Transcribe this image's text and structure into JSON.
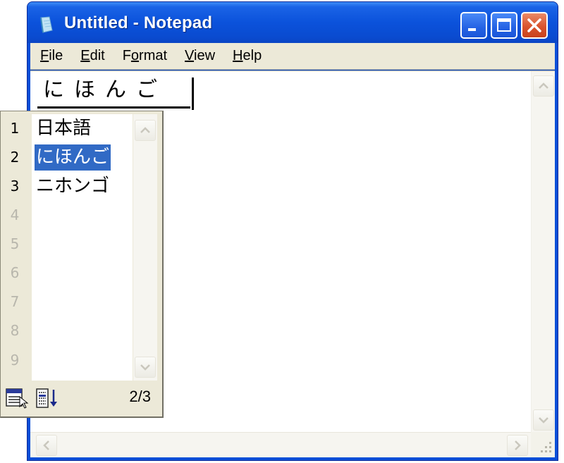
{
  "window": {
    "title": "Untitled - Notepad",
    "app_icon": "notepad-icon",
    "controls": {
      "minimize": "minimize-icon",
      "maximize": "maximize-icon",
      "close": "close-icon"
    },
    "colors": {
      "titlebar": "#0b52db",
      "close_button": "#d9542e",
      "selection": "#316ac5",
      "chrome": "#ece9d8"
    }
  },
  "menu": [
    {
      "accel": "F",
      "rest": "ile"
    },
    {
      "accel": "E",
      "rest": "dit"
    },
    {
      "pre": "F",
      "accel": "o",
      "rest": "rmat"
    },
    {
      "accel": "V",
      "rest": "iew"
    },
    {
      "accel": "H",
      "rest": "elp"
    }
  ],
  "editor": {
    "composition": "にほんご"
  },
  "ime_candidates": {
    "items": [
      {
        "number": "1",
        "text": "日本語"
      },
      {
        "number": "2",
        "text": "にほんご",
        "selected": true
      },
      {
        "number": "3",
        "text": "ニホンゴ"
      },
      {
        "number": "4",
        "text": ""
      },
      {
        "number": "5",
        "text": ""
      },
      {
        "number": "6",
        "text": ""
      },
      {
        "number": "7",
        "text": ""
      },
      {
        "number": "8",
        "text": ""
      },
      {
        "number": "9",
        "text": ""
      }
    ],
    "page_indicator": "2/3",
    "footer_icons": [
      "candidate-list-icon",
      "sort-list-icon"
    ]
  }
}
